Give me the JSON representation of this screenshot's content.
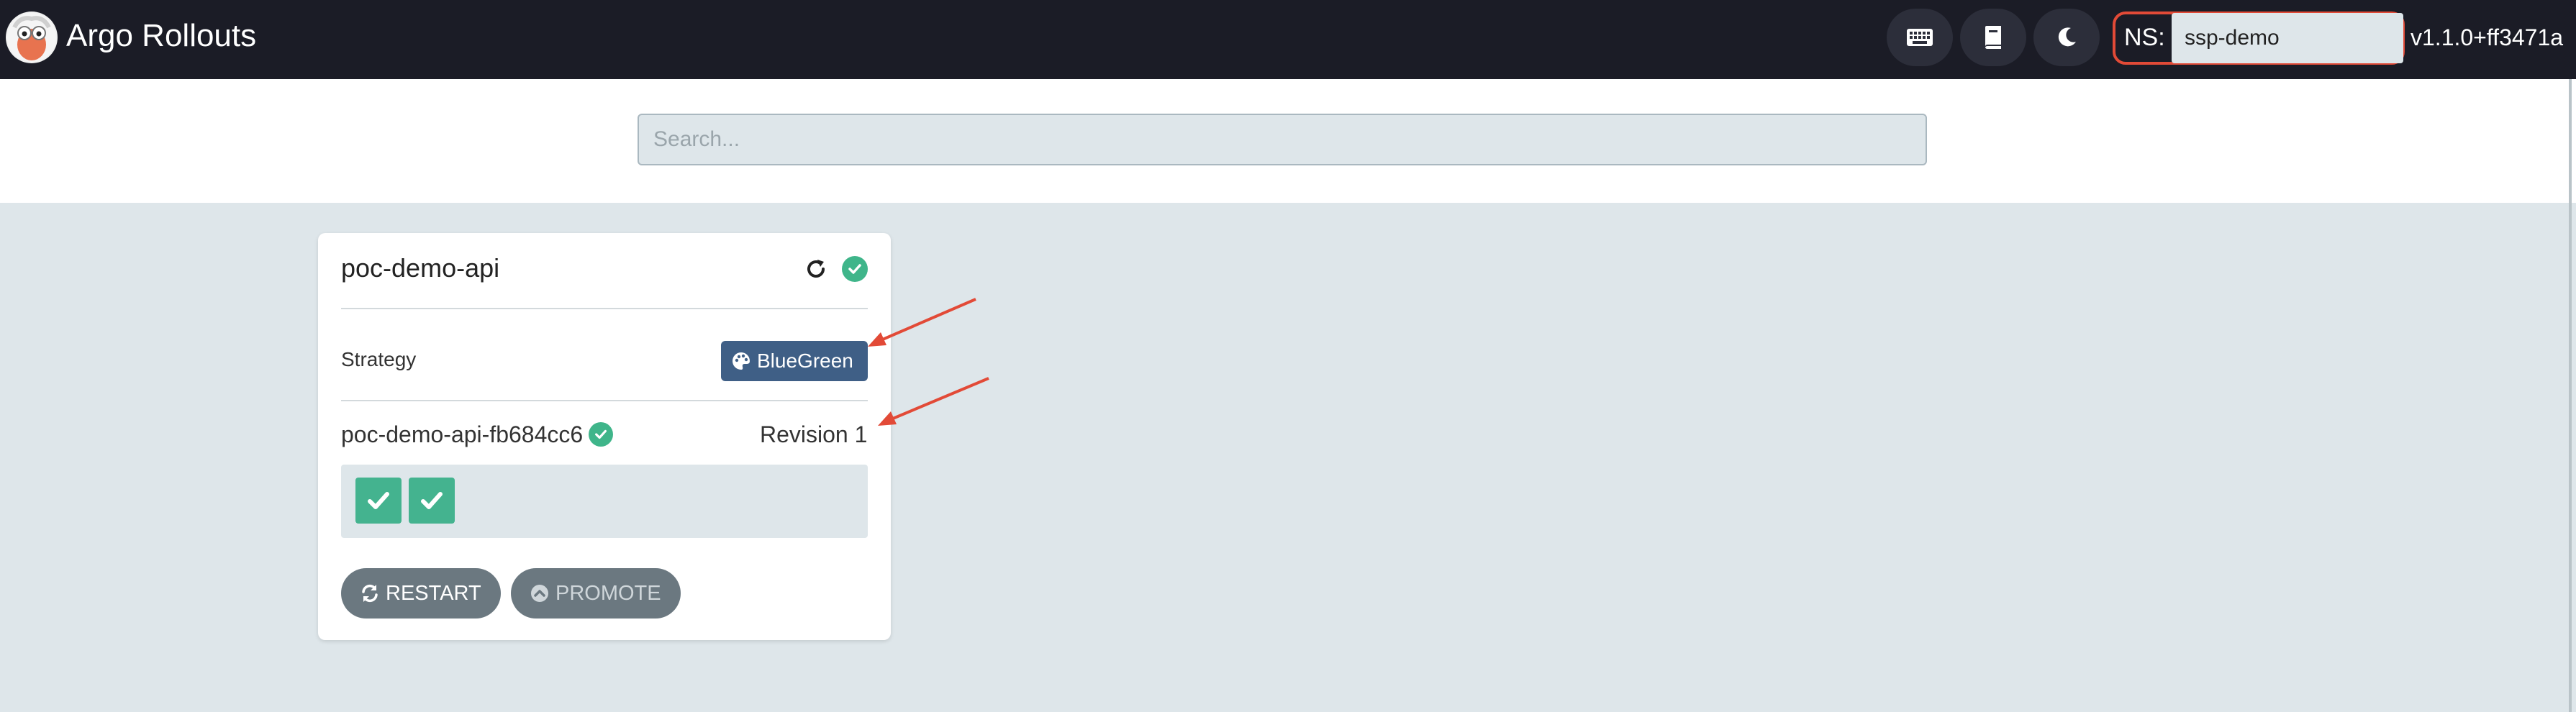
{
  "header": {
    "app_title": "Argo Rollouts",
    "namespace_label": "NS:",
    "namespace_value": "ssp-demo",
    "version": "v1.1.0+ff3471a",
    "icons": [
      "keyboard-icon",
      "book-icon",
      "moon-icon"
    ]
  },
  "search": {
    "placeholder": "Search..."
  },
  "rollout": {
    "name": "poc-demo-api",
    "status": "healthy",
    "strategy_label": "Strategy",
    "strategy": "BlueGreen",
    "replica_set": {
      "name": "poc-demo-api-fb684cc6",
      "status": "healthy",
      "revision": "Revision 1",
      "pods": [
        {
          "status": "healthy"
        },
        {
          "status": "healthy"
        }
      ]
    },
    "actions": {
      "restart": "RESTART",
      "promote": "PROMOTE"
    }
  },
  "colors": {
    "header_bg": "#1b1c26",
    "page_bg": "#dee6ea",
    "success": "#44b38f",
    "strategy_badge": "#3f5f86",
    "button_bg": "#6b7880",
    "annotation": "#e24a37"
  }
}
